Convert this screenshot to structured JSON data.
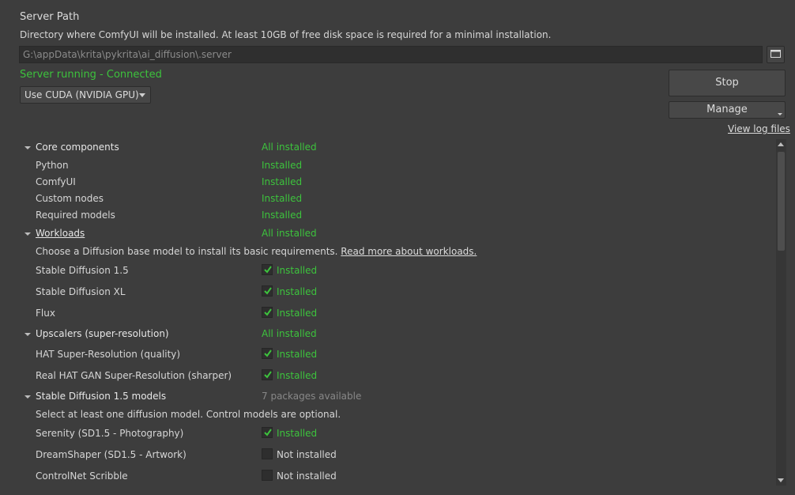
{
  "server": {
    "title": "Server Path",
    "description": "Directory where ComfyUI will be installed. At least 10GB of free disk space is required for a minimal installation.",
    "path_value": "G:\\appData\\krita\\pykrita\\ai_diffusion\\.server",
    "status": "Server running - Connected",
    "backend": "Use CUDA (NVIDIA GPU)",
    "stop_label": "Stop",
    "manage_label": "Manage",
    "log_link": "View log files"
  },
  "tree": {
    "core": {
      "label": "Core components",
      "status": "All installed",
      "items": [
        {
          "label": "Python",
          "status": "Installed"
        },
        {
          "label": "ComfyUI",
          "status": "Installed"
        },
        {
          "label": "Custom nodes",
          "status": "Installed"
        },
        {
          "label": "Required models",
          "status": "Installed"
        }
      ]
    },
    "workloads": {
      "label": "Workloads",
      "status": "All installed",
      "hint": "Choose a Diffusion base model to install its basic requirements.",
      "hint_link": "Read more about workloads.",
      "items": [
        {
          "label": "Stable Diffusion 1.5",
          "status": "Installed",
          "checked": true
        },
        {
          "label": "Stable Diffusion XL",
          "status": "Installed",
          "checked": true
        },
        {
          "label": "Flux",
          "status": "Installed",
          "checked": true
        }
      ]
    },
    "upscalers": {
      "label": "Upscalers (super-resolution)",
      "status": "All installed",
      "items": [
        {
          "label": "HAT Super-Resolution (quality)",
          "status": "Installed",
          "checked": true
        },
        {
          "label": "Real HAT GAN Super-Resolution (sharper)",
          "status": "Installed",
          "checked": true
        }
      ]
    },
    "sd15": {
      "label": "Stable Diffusion 1.5 models",
      "status": "7 packages available",
      "hint": "Select at least one diffusion model. Control models are optional.",
      "items": [
        {
          "label": "Serenity (SD1.5 - Photography)",
          "status": "Installed",
          "checked": true
        },
        {
          "label": "DreamShaper (SD1.5 - Artwork)",
          "status": "Not installed",
          "checked": false
        },
        {
          "label": "ControlNet Scribble",
          "status": "Not installed",
          "checked": false
        }
      ]
    }
  },
  "colors": {
    "background": "#3d3d3d",
    "installed_green": "#3dc33d",
    "muted_text": "#888888"
  }
}
